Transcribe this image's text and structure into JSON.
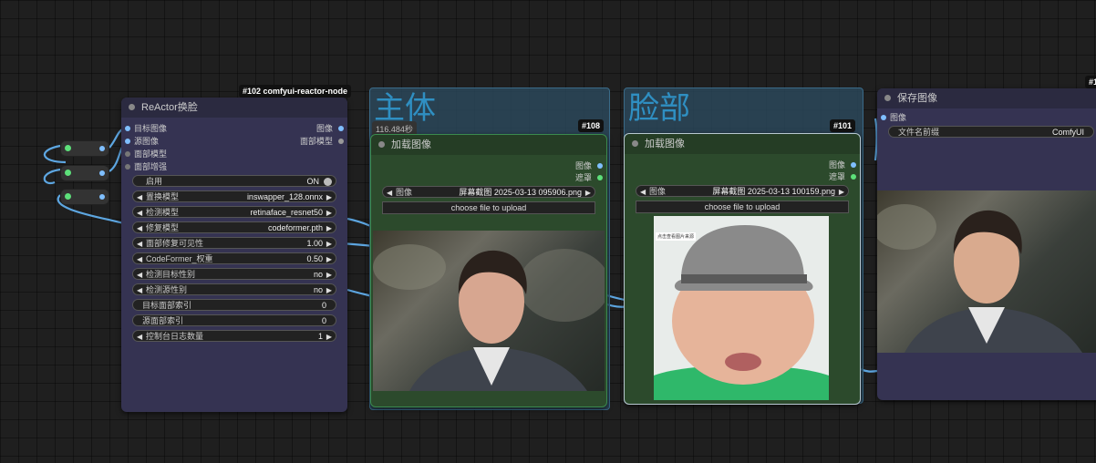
{
  "reactor_node": {
    "id_badge": "#102 comfyui-reactor-node",
    "title": "ReActor换脸",
    "inputs": [
      "目标图像",
      "源图像",
      "面部模型",
      "面部增强"
    ],
    "outputs": [
      "图像",
      "面部模型"
    ],
    "enable": {
      "label": "启用",
      "value": "ON"
    },
    "widgets": [
      {
        "label": "置换模型",
        "value": "inswapper_128.onnx"
      },
      {
        "label": "检测模型",
        "value": "retinaface_resnet50"
      },
      {
        "label": "修复模型",
        "value": "codeformer.pth"
      },
      {
        "label": "面部修复可见性",
        "value": "1.00"
      },
      {
        "label": "CodeFormer_权重",
        "value": "0.50"
      },
      {
        "label": "检测目标性别",
        "value": "no"
      },
      {
        "label": "检测源性别",
        "value": "no"
      }
    ],
    "index_widgets": [
      {
        "label": "目标面部索引",
        "value": "0"
      },
      {
        "label": "源面部索引",
        "value": "0"
      }
    ],
    "log_widget": {
      "label": "控制台日志数量",
      "value": "1"
    }
  },
  "group_main": {
    "title": "主体",
    "timing": "116.484秒",
    "node": {
      "badge": "#108",
      "title": "加载图像",
      "outputs": [
        "图像",
        "遮罩"
      ],
      "image_widget": {
        "label": "图像",
        "value": "屏幕截图 2025-03-13 095906.png"
      },
      "upload_label": "choose file to upload"
    }
  },
  "group_face": {
    "title": "脸部",
    "node": {
      "badge": "#101",
      "title": "加载图像",
      "outputs": [
        "图像",
        "遮罩"
      ],
      "image_widget": {
        "label": "图像",
        "value": "屏幕截图 2025-03-13 100159.png"
      },
      "upload_label": "choose file to upload",
      "image_caption": "点击查看图片来源"
    }
  },
  "save_node": {
    "badge": "#1",
    "title": "保存图像",
    "input": "图像",
    "prefix_widget": {
      "label": "文件名前缀",
      "value": "ComfyUI"
    }
  },
  "colors": {
    "canvas": "#1f1f1f",
    "node_body": "#353352",
    "node_title": "#2b2a40",
    "load_node_body": "#2c4a2c",
    "group_fill": "#2d4d63",
    "wire_image": "#64b5f6",
    "reroute_dot": "#5de07a"
  }
}
